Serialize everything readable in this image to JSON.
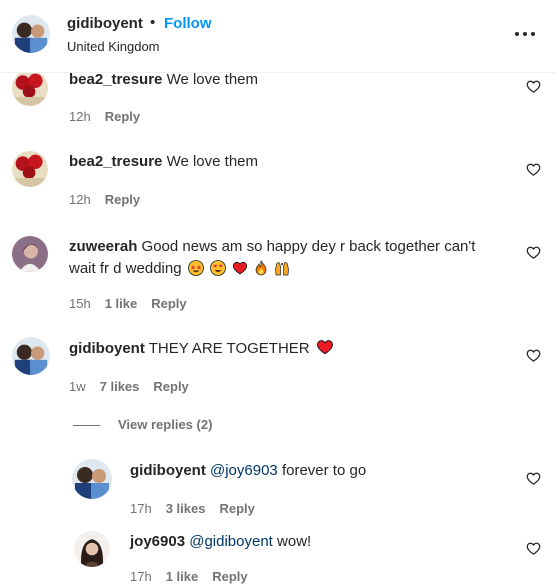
{
  "post_header": {
    "username": "gidiboyent",
    "separator": "•",
    "follow_label": "Follow",
    "location": "United Kingdom"
  },
  "comments": [
    {
      "username": "bea2_tresure",
      "text": "We love them",
      "time": "12h",
      "reply_label": "Reply"
    },
    {
      "username": "bea2_tresure",
      "text": "We love them",
      "time": "12h",
      "reply_label": "Reply"
    },
    {
      "username": "zuweerah",
      "text": "Good news am so happy dey r back together can't",
      "text_line2": "wait fr d wedding",
      "time": "15h",
      "likes": "1 like",
      "reply_label": "Reply"
    },
    {
      "username": "gidiboyent",
      "text": "THEY ARE TOGETHER",
      "time": "1w",
      "likes": "7 likes",
      "reply_label": "Reply"
    }
  ],
  "view_replies_label": "View replies (2)",
  "replies": [
    {
      "username": "gidiboyent",
      "mention": "@joy6903",
      "text": "forever to go",
      "time": "17h",
      "likes": "3 likes",
      "reply_label": "Reply"
    },
    {
      "username": "joy6903",
      "mention": "@gidiboyent",
      "text": "wow!",
      "time": "17h",
      "likes": "1 like",
      "reply_label": "Reply"
    }
  ],
  "icons": {
    "like": "heart-outline-icon",
    "more": "more-options-icon",
    "emoji": [
      "star-struck-emoji",
      "heart-eyes-emoji",
      "red-heart-emoji",
      "fire-emoji",
      "raising-hands-emoji"
    ]
  },
  "colors": {
    "accent": "#0095f6",
    "text": "#262626",
    "secondary": "#737373",
    "heart": "#ed4956"
  }
}
